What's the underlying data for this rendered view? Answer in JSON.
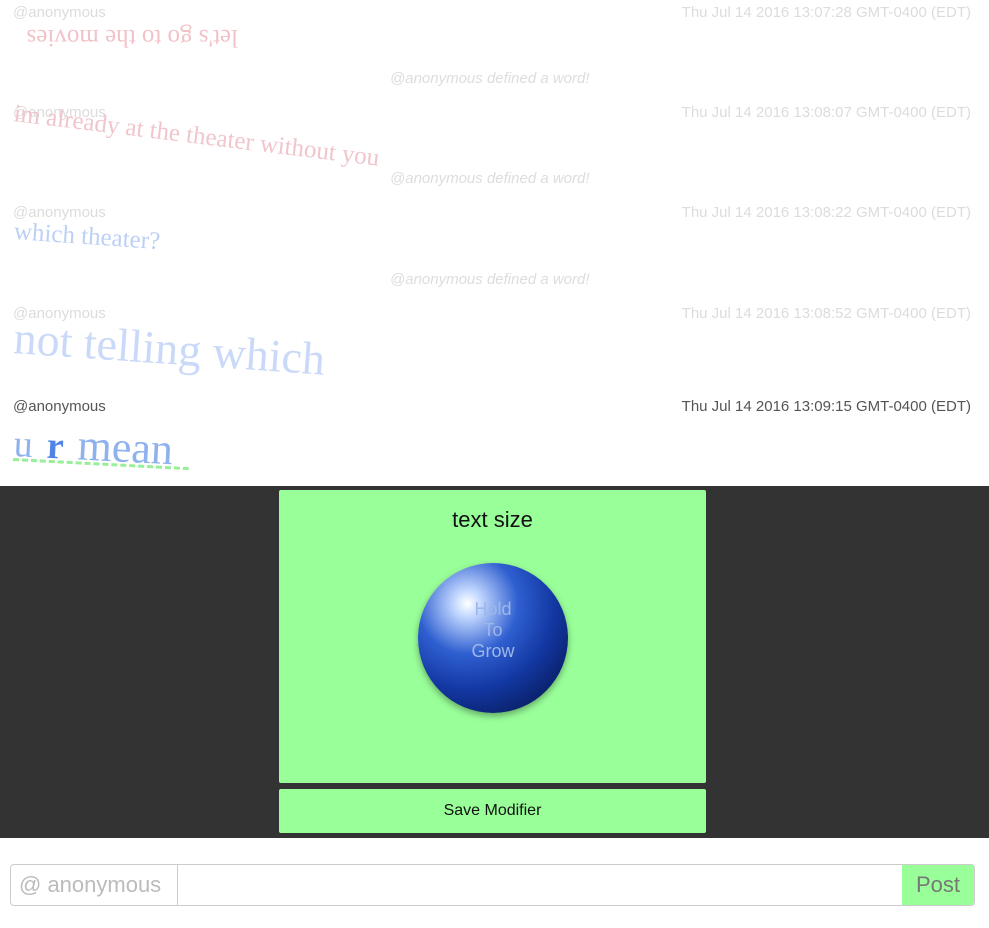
{
  "messages": [
    {
      "author": "@anonymous",
      "time": "Thu Jul 14 2016 13:07:28 GMT-0400 (EDT)",
      "text": "let's go to the movies",
      "color": "#f2c2c8",
      "defined": "@anonymous defined a word!"
    },
    {
      "author": "@anonymous",
      "time": "Thu Jul 14 2016 13:08:07 GMT-0400 (EDT)",
      "text": "im already at the theater without you",
      "color": "#f0c6cc",
      "defined": "@anonymous defined a word!"
    },
    {
      "author": "@anonymous",
      "time": "Thu Jul 14 2016 13:08:22 GMT-0400 (EDT)",
      "text": "which theater?",
      "color": "#bcd0f5",
      "defined": "@anonymous defined a word!"
    },
    {
      "author": "@anonymous",
      "time": "Thu Jul 14 2016 13:08:52 GMT-0400 (EDT)",
      "text": "not telling which",
      "color": "#c9d9f7"
    },
    {
      "author": "@anonymous",
      "time": "Thu Jul 14 2016 13:09:15 GMT-0400 (EDT)",
      "words": [
        "u",
        "r",
        "mean"
      ],
      "colors": [
        "#8fb2ee",
        "#4f84e6",
        "#8fb2ee"
      ],
      "underline_color": "#99ee99"
    }
  ],
  "modifier": {
    "title": "text size",
    "orb_label": "Hold To Grow",
    "save_label": "Save Modifier",
    "card_color": "#99ff99"
  },
  "composer": {
    "handle": "@ anonymous",
    "message_value": "",
    "post_label": "Post"
  }
}
